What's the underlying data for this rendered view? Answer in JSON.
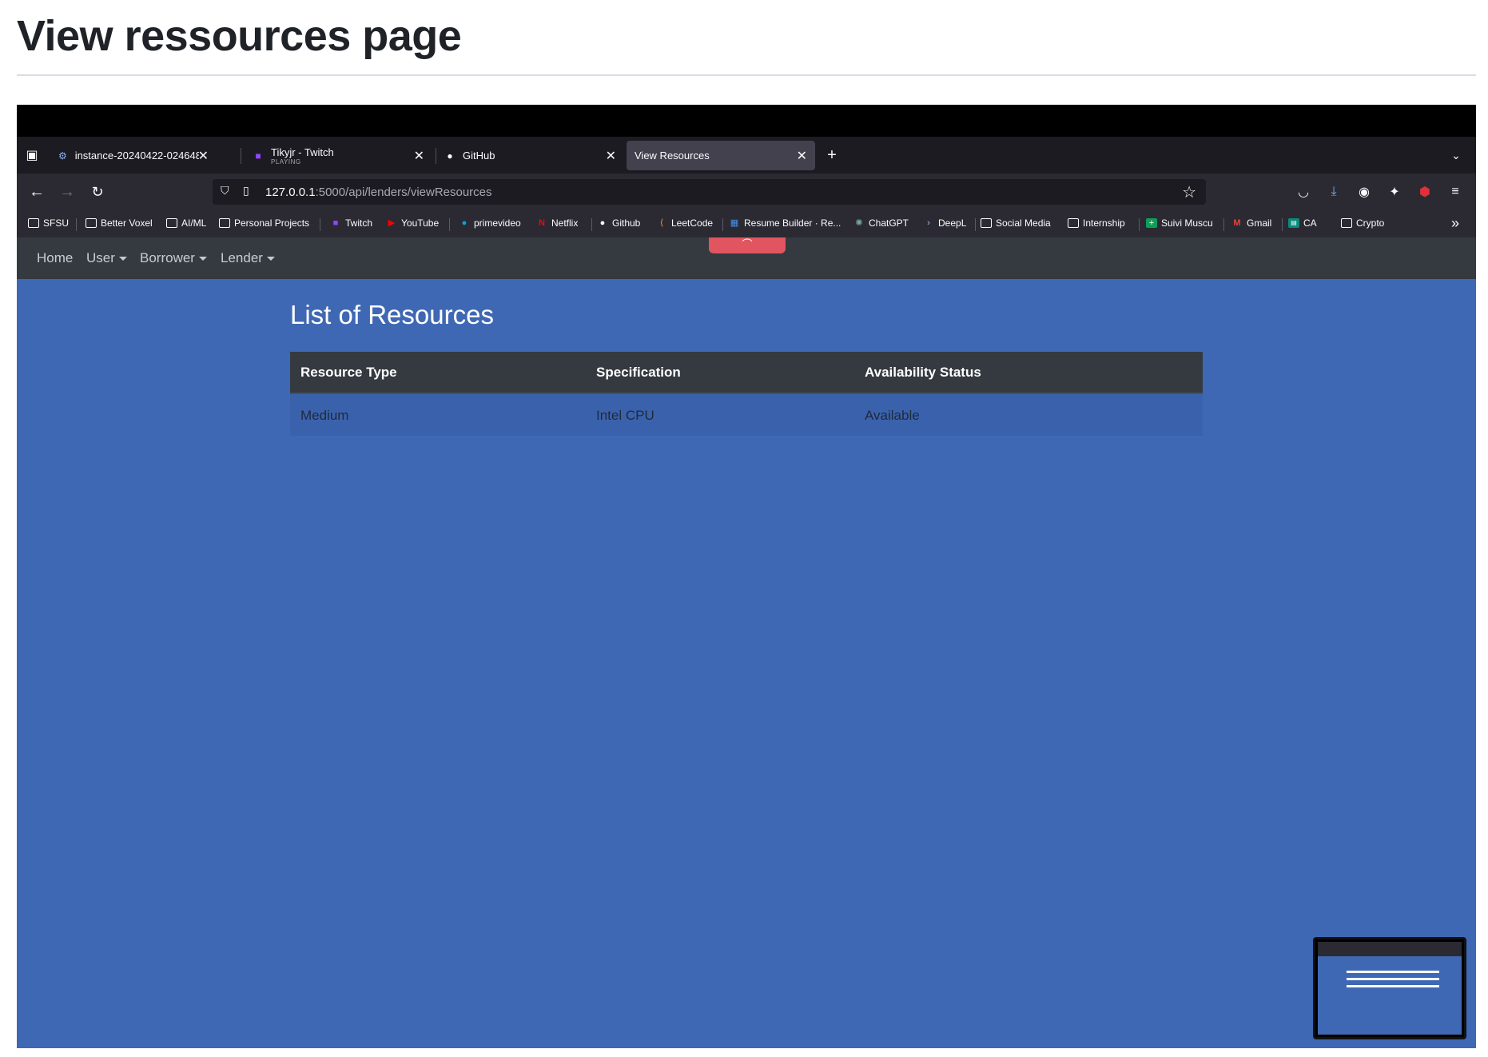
{
  "page": {
    "title": "View ressources page"
  },
  "browser": {
    "tabs": [
      {
        "label": "instance-20240422-024648 – ",
        "sub": "",
        "icon": "chip-icon"
      },
      {
        "label": "Tikyjr - Twitch",
        "sub": "PLAYING",
        "icon": "twitch-icon"
      },
      {
        "label": "GitHub",
        "sub": "",
        "icon": "github-icon"
      },
      {
        "label": "View Resources",
        "sub": "",
        "icon": ""
      }
    ],
    "url_host": "127.0.0.1",
    "url_rest": ":5000/api/lenders/viewResources",
    "bookmarks": [
      "SFSU",
      "Better Voxel",
      "AI/ML",
      "Personal Projects",
      "Twitch",
      "YouTube",
      "primevideo",
      "Netflix",
      "Github",
      "LeetCode",
      "Resume Builder · Re...",
      "ChatGPT",
      "DeepL",
      "Social Media",
      "Internship",
      "Suivi Muscu",
      "Gmail",
      "CA",
      "Crypto"
    ]
  },
  "app_nav": {
    "home": "Home",
    "user": "User",
    "borrower": "Borrower",
    "lender": "Lender"
  },
  "content": {
    "title": "List of Resources",
    "columns": [
      "Resource Type",
      "Specification",
      "Availability Status"
    ],
    "rows": [
      [
        "Medium",
        "Intel CPU",
        "Available"
      ]
    ]
  },
  "colors": {
    "page_bg": "#3f68b4",
    "table_header": "#343a40",
    "navbar": "#343a40",
    "accent_red": "#e05560"
  }
}
